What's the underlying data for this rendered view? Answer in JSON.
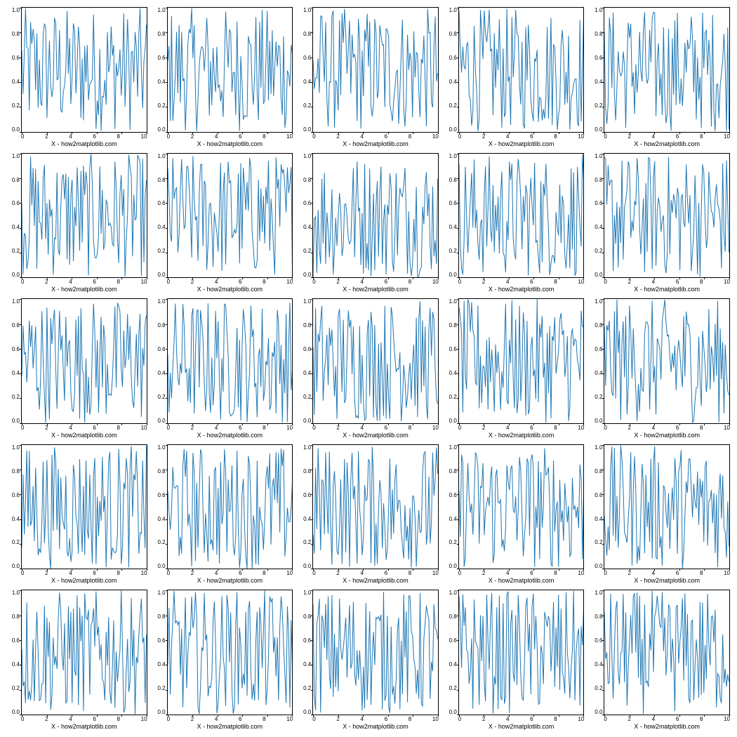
{
  "chart_data": {
    "type": "line",
    "grid": {
      "rows": 5,
      "cols": 5
    },
    "xlabel": "X - how2matplotlib.com",
    "xlim": [
      0,
      10
    ],
    "ylim": [
      0.0,
      1.0
    ],
    "x_ticks": [
      "0",
      "2",
      "4",
      "6",
      "8",
      "10"
    ],
    "y_ticks": [
      "1.0",
      "0.8",
      "0.6",
      "0.4",
      "0.2",
      "0.0"
    ],
    "line_color": "#1f77b4",
    "note": "each panel shows ~100 random noise samples in [0,1]; values unreadable at pixel precision",
    "series_per_panel": {
      "n_points": 100,
      "x": "linspace 0..10",
      "y": "uniform random [0,1]"
    }
  }
}
